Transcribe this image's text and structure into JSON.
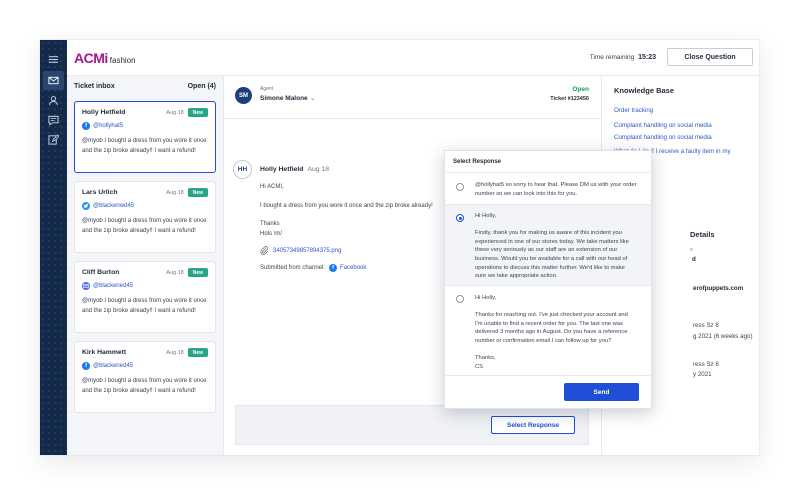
{
  "app": {
    "brand": "ACMi",
    "sub": "fashion"
  },
  "header": {
    "timer_label": "Time remaining",
    "timer_value": "15:23",
    "close_label": "Close Question"
  },
  "nav": {
    "icons": [
      "menu-icon",
      "inbox-icon",
      "user-icon",
      "chat-icon",
      "edit-icon"
    ],
    "active": "inbox-icon"
  },
  "inbox": {
    "title": "Ticket inbox",
    "count": "Open (4)",
    "tickets": [
      {
        "name": "Holly Hetfield",
        "date": "Aug 18",
        "badge": "New",
        "channel": "facebook",
        "handle": "@hollyhat5",
        "message": "@myob I bought a dress from you wore it once and the zip broke already!! I want a refund!"
      },
      {
        "name": "Lars Urlich",
        "date": "Aug 18",
        "badge": "New",
        "channel": "twitter",
        "handle": "@blackenwd45",
        "message": "@myob I bought a dress from you wore it once and the zip broke already!! I want a refund!"
      },
      {
        "name": "Cliff Burton",
        "date": "Aug 18",
        "badge": "New",
        "channel": "email",
        "handle": "@blackened45",
        "message": "@myob I bought a dress from you wore it once and the zip broke already!! I want a refund!"
      },
      {
        "name": "Kirk Hammett",
        "date": "Aug 18",
        "badge": "New",
        "channel": "facebook",
        "handle": "@blackened45",
        "message": "@myob I bought a dress from you wore it once and the zip broke already!! I want a refund!"
      }
    ]
  },
  "conversation": {
    "agent_initials": "SM",
    "agent_label": "Agent",
    "agent_name": "Simone Malone",
    "status": "Open",
    "ticket": "Ticket #123456",
    "message": {
      "initials": "HH",
      "from": "Holly Hetfield",
      "date": "Aug 18",
      "greeting": "Hi ACMI,",
      "body": "I bought a dress from you wore it once and the zip broke already!",
      "sign1": "Thanks",
      "sign2": "Hols \\m/",
      "attachment": "34057349857894375.png",
      "channel_label": "Submitted from channel:",
      "channel_name": "Facebook"
    },
    "select_response_label": "Select Response"
  },
  "knowledge_base": {
    "title": "Knowledge Base",
    "links": [
      "Order tracking",
      "Complaint handling on social media",
      "Complaint handling on social media",
      "What do I do if I receive a faulty item in my"
    ],
    "details_title": "Details",
    "details": [
      {
        "text": "e",
        "style": "g"
      },
      {
        "text": "d",
        "style": "b"
      },
      {
        "text": "erofpuppets.com",
        "style": "b"
      },
      {
        "text": "ress Sz 8",
        "style": ""
      },
      {
        "text": "g 2021 (6 weeks ago)",
        "style": ""
      },
      {
        "text": "ress Sz 8",
        "style": ""
      },
      {
        "text": "y 2021",
        "style": ""
      }
    ]
  },
  "popup": {
    "title": "Select Response",
    "options": [
      {
        "text": "@hollyhat5 so sorry to hear that. Please DM us with your order number so we can look into this for you.",
        "selected": false
      },
      {
        "text": "Hi Holly,\n\nFirstly, thank you for making us aware of this incident you experienced in one of our stores today. We take matters like these very seriously as our staff are an extension of our business. Would you be available for a call with our head of operations to discuss this matter further. We'd like to make sure we take appropriate action.",
        "selected": true
      },
      {
        "text": "Hi Holly,\n\nThanks for reaching out. I've just checked your account and I'm unable to find a recent order for you. The last one was delivered 3 months ago in August. Do you have a reference number or confirmation email I can follow up for you?\n\nThanks,\nCS",
        "selected": false
      }
    ],
    "send_label": "Send"
  }
}
